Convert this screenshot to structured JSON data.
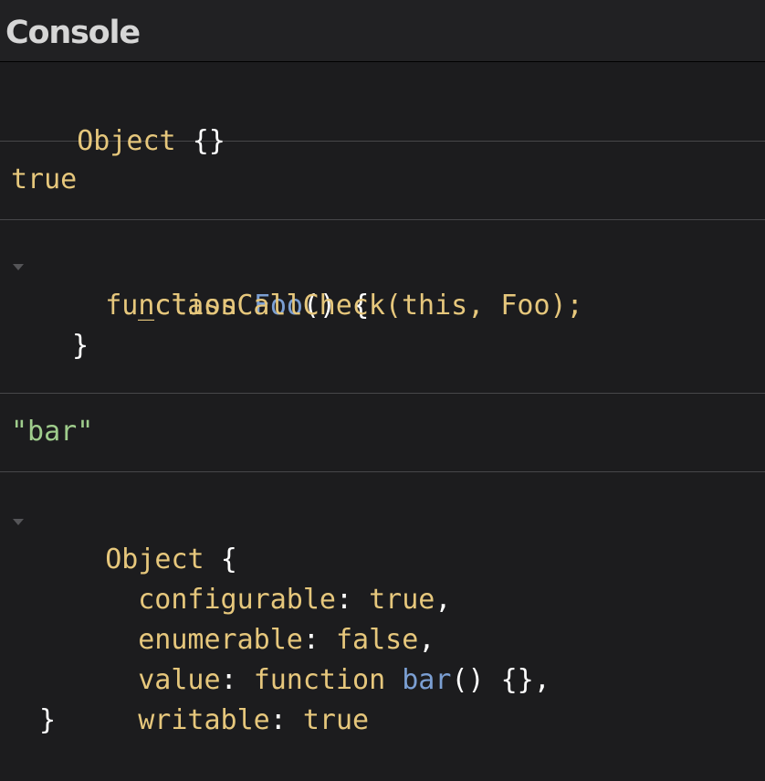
{
  "header": {
    "title": "Console"
  },
  "entries": {
    "obj1": {
      "label": "Object",
      "braces": "{}"
    },
    "bool": {
      "value": "true"
    },
    "fn": {
      "keyword": "function",
      "name": "Foo",
      "parens": "()",
      "open": "{",
      "body": "_classCallCheck(this, Foo);",
      "close": "}"
    },
    "str": {
      "value": "\"bar\""
    },
    "obj2": {
      "label": "Object",
      "open": "{",
      "props": [
        {
          "key": "configurable",
          "sep": ": ",
          "value": "true",
          "comma": ","
        },
        {
          "key": "enumerable",
          "sep": ": ",
          "value": "false",
          "comma": ","
        },
        {
          "key": "value",
          "sep": ": ",
          "value_keyword": "function",
          "value_name": "bar",
          "value_parens": "()",
          "value_braces": "{}",
          "comma": ","
        },
        {
          "key": "writable",
          "sep": ": ",
          "value": "true"
        }
      ],
      "close": "}"
    }
  },
  "colors": {
    "background": "#1c1c1e",
    "text": "#e6c77c",
    "function_name": "#7b9fd3",
    "string": "#9fcd8c",
    "punctuation": "#ffffff"
  },
  "icons": [
    "disclosure-triangle-icon"
  ]
}
